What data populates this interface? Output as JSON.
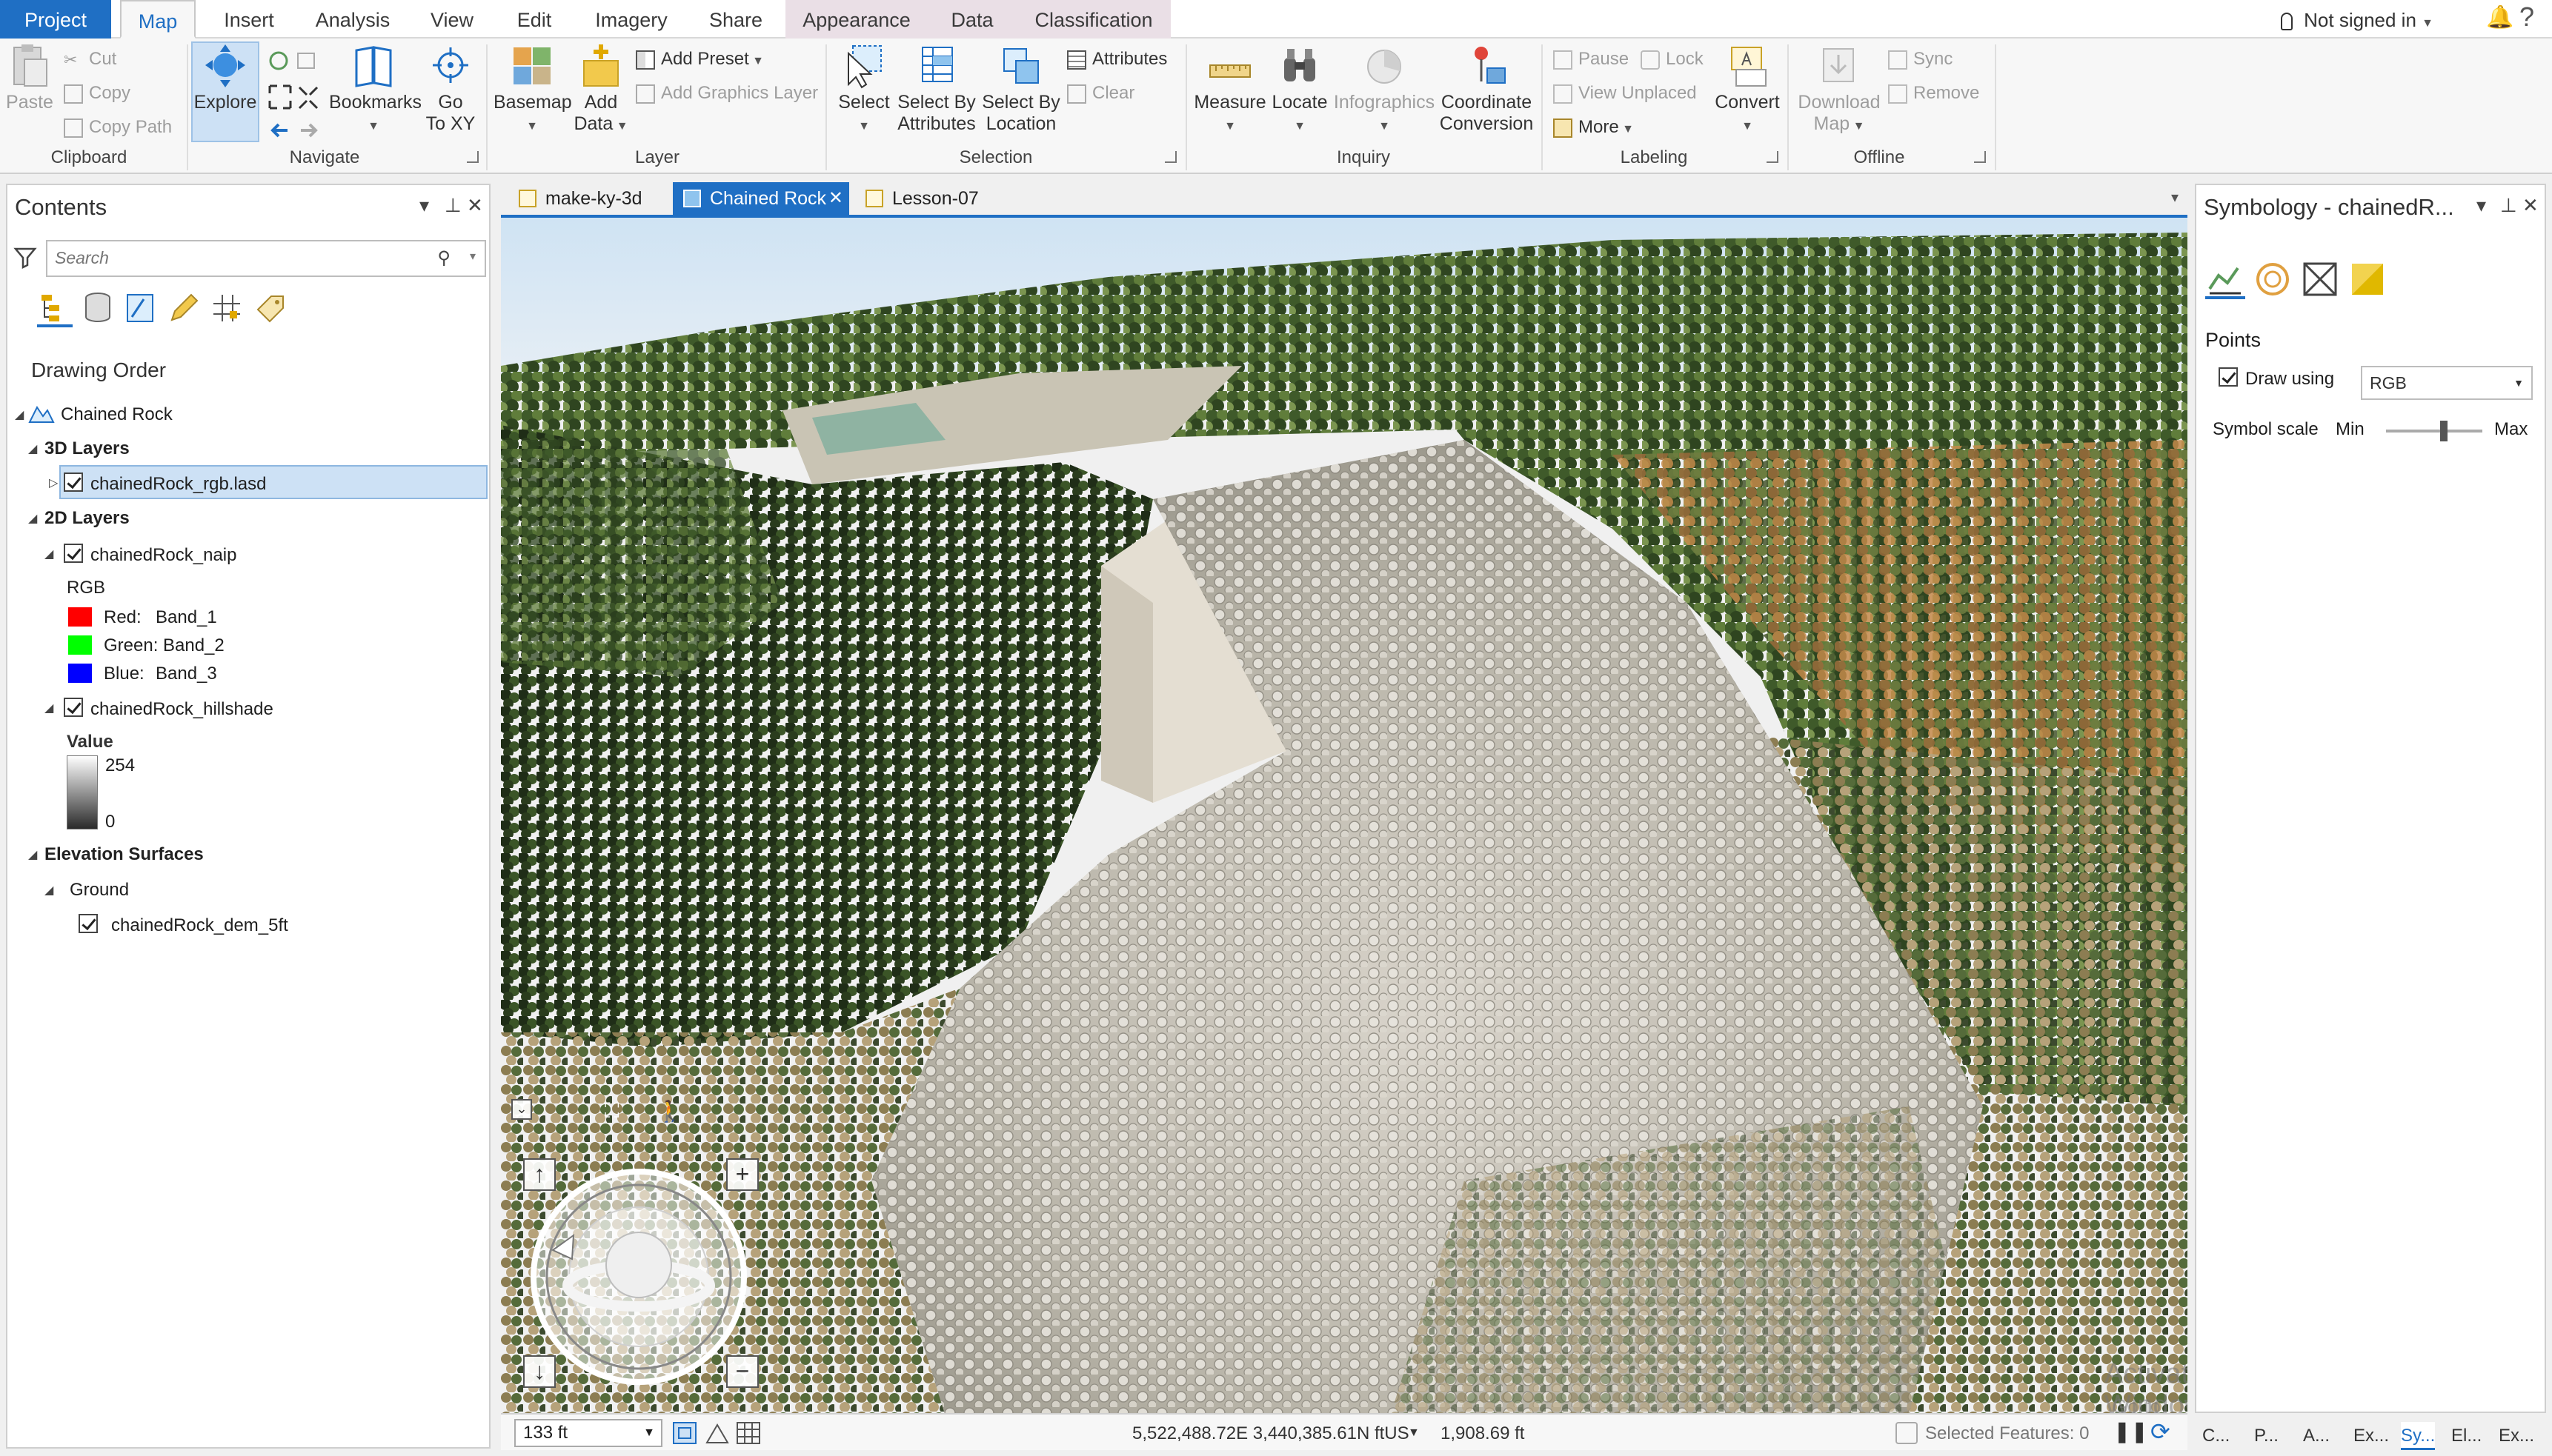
{
  "ribbon_tabs": [
    {
      "label": "Project"
    },
    {
      "label": "Map"
    },
    {
      "label": "Insert"
    },
    {
      "label": "Analysis"
    },
    {
      "label": "View"
    },
    {
      "label": "Edit"
    },
    {
      "label": "Imagery"
    },
    {
      "label": "Share"
    },
    {
      "label": "Appearance"
    },
    {
      "label": "Data"
    },
    {
      "label": "Classification"
    }
  ],
  "active_ribbon_tab": "Map",
  "signin": "Not signed in",
  "ribbon": {
    "clipboard": {
      "paste": "Paste",
      "cut": "Cut",
      "copy": "Copy",
      "copy_path": "Copy Path",
      "label": "Clipboard"
    },
    "navigate": {
      "explore": "Explore",
      "bookmarks": "Bookmarks",
      "goto_line1": "Go",
      "goto_line2": "To XY",
      "label": "Navigate"
    },
    "layer": {
      "basemap": "Basemap",
      "add_data_line1": "Add",
      "add_data_line2": "Data",
      "add_preset": "Add Preset",
      "add_graphics_layer": "Add Graphics Layer",
      "label": "Layer"
    },
    "selection": {
      "select": "Select",
      "by_attr_line1": "Select By",
      "by_attr_line2": "Attributes",
      "by_loc_line1": "Select By",
      "by_loc_line2": "Location",
      "attributes": "Attributes",
      "clear": "Clear",
      "label": "Selection"
    },
    "inquiry": {
      "measure": "Measure",
      "locate": "Locate",
      "infographics": "Infographics",
      "coord_line1": "Coordinate",
      "coord_line2": "Conversion",
      "label": "Inquiry"
    },
    "labeling": {
      "pause": "Pause",
      "lock": "Lock",
      "view_unplaced": "View Unplaced",
      "more": "More",
      "convert": "Convert",
      "label": "Labeling"
    },
    "offline": {
      "download_line1": "Download",
      "download_line2": "Map",
      "sync": "Sync",
      "remove": "Remove",
      "label": "Offline"
    }
  },
  "contents": {
    "title": "Contents",
    "search_placeholder": "Search",
    "drawing_order": "Drawing Order",
    "map_name": "Chained Rock",
    "group_3d": "3D Layers",
    "layer_rgb": "chainedRock_rgb.lasd",
    "group_2d": "2D Layers",
    "layer_naip": "chainedRock_naip",
    "rgb_heading": "RGB",
    "bands": [
      {
        "name": "Red:",
        "value": "Band_1",
        "color": "#ff0000"
      },
      {
        "name": "Green:",
        "value": "Band_2",
        "color": "#00ff00"
      },
      {
        "name": "Blue:",
        "value": "Band_3",
        "color": "#0000ff"
      }
    ],
    "layer_hillshade": "chainedRock_hillshade",
    "value_heading": "Value",
    "value_max": "254",
    "value_min": "0",
    "group_elev": "Elevation Surfaces",
    "ground": "Ground",
    "layer_dem": "chainedRock_dem_5ft"
  },
  "map_tabs": [
    {
      "label": "make-ky-3d"
    },
    {
      "label": "Chained Rock",
      "active": true
    },
    {
      "label": "Lesson-07"
    }
  ],
  "status": {
    "scale": "133 ft",
    "coordinates": "5,522,488.72E 3,440,385.61N ftUS",
    "elevation": "1,908.69 ft",
    "selected_features": "Selected Features: 0"
  },
  "watermark": {
    "line1": "Activate Windows",
    "line2": "Go to Settings to activate Windows."
  },
  "symbology": {
    "title": "Symbology - chainedR...",
    "points": "Points",
    "draw_using": "Draw using",
    "draw_using_value": "RGB",
    "symbol_scale": "Symbol scale",
    "min": "Min",
    "max": "Max",
    "slider_value": 0.6
  },
  "bottom_tabs": [
    {
      "label": "C..."
    },
    {
      "label": "P..."
    },
    {
      "label": "A..."
    },
    {
      "label": "Ex..."
    },
    {
      "label": "Sy...",
      "active": true
    },
    {
      "label": "El..."
    },
    {
      "label": "Ex..."
    }
  ],
  "colors": {
    "accent": "#1f6fc4",
    "selected": "#cde1f5",
    "contextual_tabs": "#eadfe6"
  }
}
